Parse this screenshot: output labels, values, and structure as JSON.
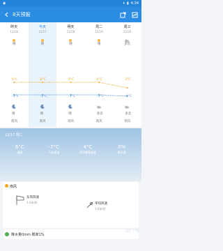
{
  "status": {
    "time": "4:34"
  },
  "app": {
    "title": "8天预报"
  },
  "days": [
    {
      "weekday": "昨天",
      "date": "12/16",
      "day_weather": "晴",
      "day_icon": "sun",
      "night_weather": "晴",
      "night_icon": "moon",
      "high": "6°C",
      "low": "-3°C",
      "wind": "南风"
    },
    {
      "weekday": "今天",
      "date": "12/17",
      "day_weather": "晴",
      "day_icon": "sun",
      "night_weather": "晴",
      "night_icon": "moon",
      "high": "6°C",
      "low": "-3°C",
      "wind": "南风"
    },
    {
      "weekday": "明天",
      "date": "12/18",
      "day_weather": "晴",
      "day_icon": "sun",
      "night_weather": "晴",
      "night_icon": "moon",
      "high": "6°C",
      "low": "-3°C",
      "wind": "南风"
    },
    {
      "weekday": "周二",
      "date": "12/19",
      "day_weather": "晴",
      "day_icon": "sun",
      "night_weather": "多云",
      "night_icon": "cloud",
      "high": "6°C",
      "low": "-3°C",
      "wind": "南风"
    },
    {
      "weekday": "周三",
      "date": "12/20",
      "day_weather": "多云",
      "day_icon": "cloud",
      "night_weather": "多云",
      "night_icon": "cloud",
      "high": "2°C",
      "low": "-4°C",
      "wind": "南风"
    }
  ],
  "today_detail": {
    "date_line": "12/17 周二",
    "items": [
      {
        "value": "6°C",
        "label": "温度"
      },
      {
        "value": "-7°C",
        "label": "人体感温"
      },
      {
        "value": "4°C",
        "label": "明日最高温度"
      },
      {
        "value": "0%",
        "label": "降水量"
      }
    ]
  },
  "wind_card": {
    "title": "南风",
    "left_title": "东风风速",
    "left_sub": "3.6米/秒",
    "right_title": "平均风速",
    "right_sub": "3.6米/秒"
  },
  "rain_card": {
    "text": "降水量0mm 概率1%"
  },
  "watermark": "飞翔下载"
}
